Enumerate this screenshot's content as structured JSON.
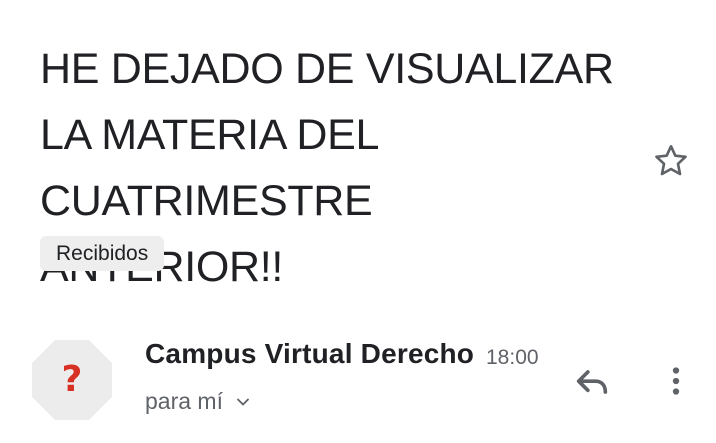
{
  "email": {
    "subject": "HE DEJADO DE VISUALIZAR LA MATERIA DEL CUATRIMESTRE ANTERIOR!!",
    "label": "Recibidos",
    "sender": "Campus Virtual Derecho",
    "time": "18:00",
    "recipient": "para mí"
  },
  "avatar": {
    "symbol": "?",
    "background_color": "#ececec",
    "symbol_color": "#d93025"
  },
  "icons": {
    "star": "star-outline-icon",
    "reply": "reply-arrow-icon",
    "more": "more-vertical-icon",
    "expand": "chevron-down-icon"
  }
}
